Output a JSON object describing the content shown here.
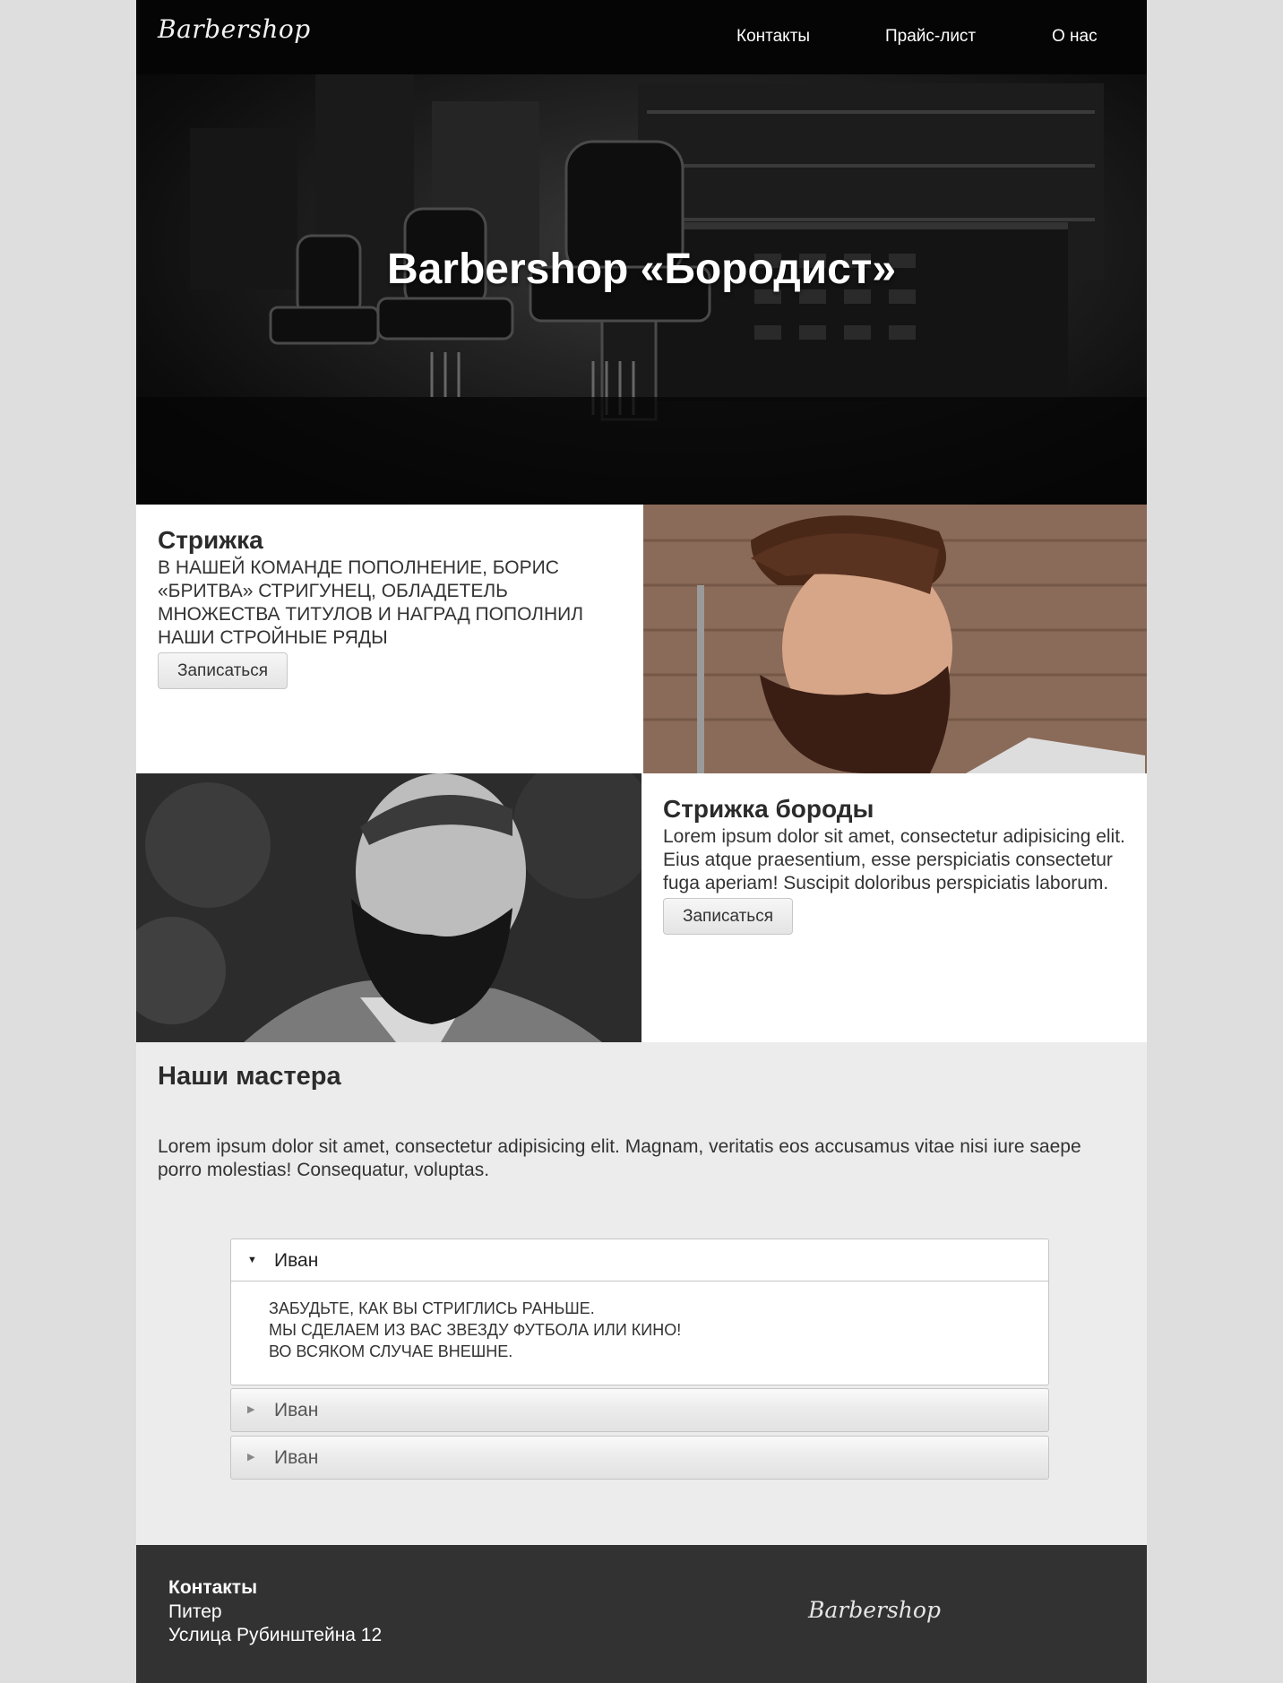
{
  "header": {
    "logo": "Barbershop",
    "nav": [
      {
        "label": "Контакты"
      },
      {
        "label": "Прайс-лист"
      },
      {
        "label": "О нас"
      }
    ]
  },
  "hero": {
    "title": "Barbershop «Бородист»"
  },
  "services": [
    {
      "title": "Стрижка",
      "text": "В НАШЕЙ КОМАНДЕ ПОПОЛНЕНИЕ, БОРИС «БРИТВА» СТРИГУНЕЦ, ОБЛАДЕТЕЛЬ МНОЖЕСТВА ТИТУЛОВ И НАГРАД ПОПОЛНИЛ НАШИ СТРОЙНЫЕ РЯДЫ",
      "button": "Записаться"
    },
    {
      "title": "Стрижка бороды",
      "text": "Lorem ipsum dolor sit amet, consectetur adipisicing elit. Eius atque praesentium, esse perspiciatis consectetur fuga aperiam! Suscipit doloribus perspiciatis laborum.",
      "button": "Записаться"
    }
  ],
  "masters": {
    "title": "Наши мастера",
    "text": "Lorem ipsum dolor sit amet, consectetur adipisicing elit. Magnam, veritatis eos accusamus vitae nisi iure saepe porro molestias! Consequatur, voluptas.",
    "accordion": [
      {
        "name": "Иван",
        "expanded": true,
        "lines": [
          "ЗАБУДЬТЕ, КАК ВЫ СТРИГЛИСЬ РАНЬШЕ.",
          "МЫ СДЕЛАЕМ ИЗ ВАС ЗВЕЗДУ ФУТБОЛА ИЛИ КИНО!",
          "ВО ВСЯКОМ СЛУЧАЕ ВНЕШНЕ."
        ]
      },
      {
        "name": "Иван",
        "expanded": false
      },
      {
        "name": "Иван",
        "expanded": false
      }
    ]
  },
  "footer": {
    "title": "Контакты",
    "city": "Питер",
    "address": "Услица Рубинштейна 12",
    "logo": "Barbershop"
  }
}
